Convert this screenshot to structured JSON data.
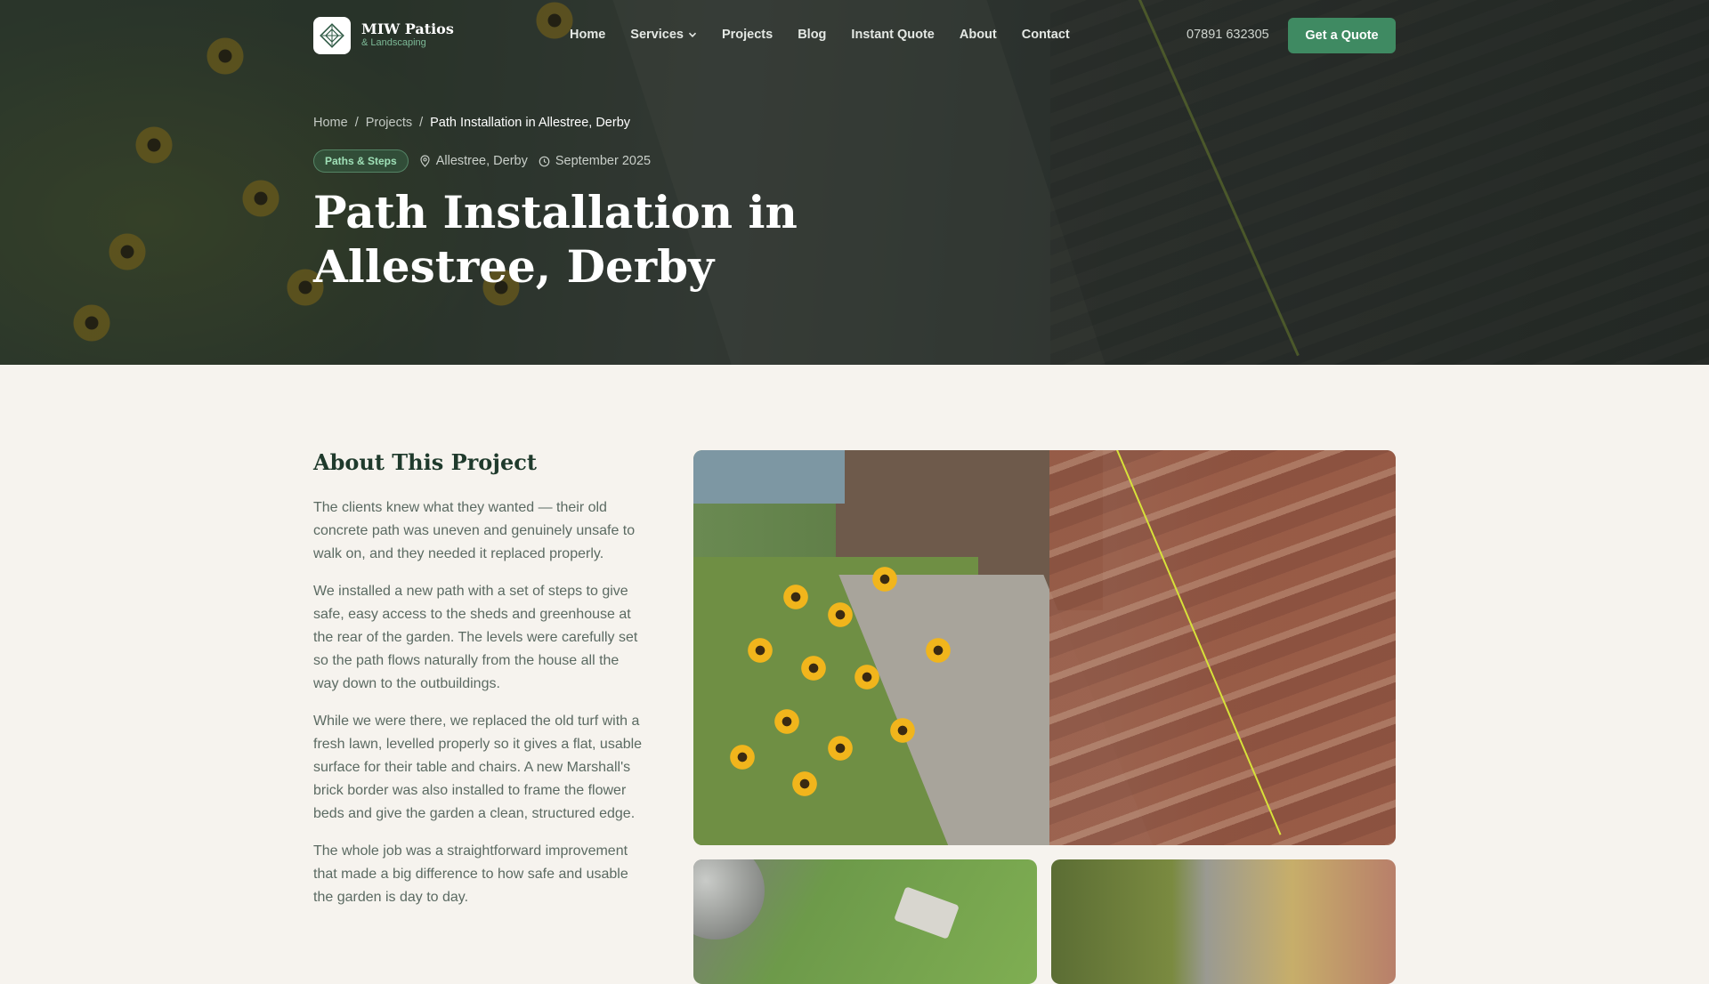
{
  "brand": {
    "name": "MIW Patios",
    "tagline": "& Landscaping"
  },
  "nav": {
    "links": [
      {
        "label": "Home"
      },
      {
        "label": "Services"
      },
      {
        "label": "Projects"
      },
      {
        "label": "Blog"
      },
      {
        "label": "Instant Quote"
      },
      {
        "label": "About"
      },
      {
        "label": "Contact"
      }
    ],
    "phone": "07891 632305",
    "cta": "Get a Quote"
  },
  "breadcrumb": {
    "home": "Home",
    "sep1": "/",
    "projects": "Projects",
    "sep2": "/",
    "current": "Path Installation in Allestree, Derby"
  },
  "project": {
    "category": "Paths & Steps",
    "location": "Allestree, Derby",
    "date": "September 2025",
    "title": "Path Installation in Allestree, Derby"
  },
  "about": {
    "heading": "About This Project",
    "paragraphs": [
      "The clients knew what they wanted — their old concrete path was uneven and genuinely unsafe to walk on, and they needed it replaced properly.",
      "We installed a new path with a set of steps to give safe, easy access to the sheds and greenhouse at the rear of the garden. The levels were carefully set so the path flows naturally from the house all the way down to the outbuildings.",
      "While we were there, we replaced the old turf with a fresh lawn, levelled properly so it gives a flat, usable surface for their table and chairs. A new Marshall's brick border was also installed to frame the flower beds and give the garden a clean, structured edge.",
      "The whole job was a straightforward improvement that made a big difference to how safe and usable the garden is day to day."
    ]
  },
  "icons": {
    "logo": "diamond-logo-icon",
    "services_caret": "chevron-down-icon",
    "location": "map-pin-icon",
    "date": "clock-icon"
  },
  "colors": {
    "accent": "#3f8a62",
    "heading": "#1f3a2c",
    "background": "#f6f3ee"
  }
}
